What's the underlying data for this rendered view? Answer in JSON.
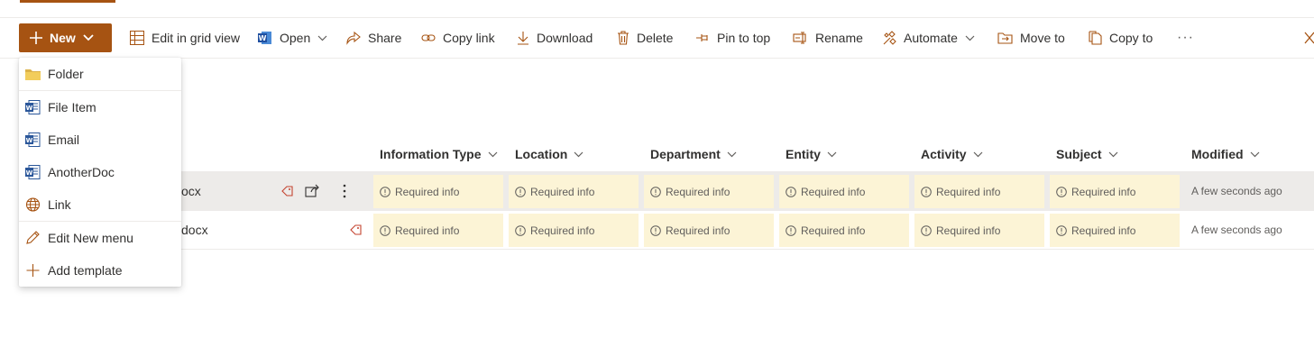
{
  "toolbar": {
    "new_label": "New",
    "commands": [
      {
        "label": "Edit in grid view",
        "icon": "grid-icon"
      },
      {
        "label": "Open",
        "icon": "word-icon"
      },
      {
        "label": "Share",
        "icon": "share-icon"
      },
      {
        "label": "Copy link",
        "icon": "link-icon"
      },
      {
        "label": "Download",
        "icon": "download-icon"
      },
      {
        "label": "Delete",
        "icon": "trash-icon"
      },
      {
        "label": "Pin to top",
        "icon": "pin-icon"
      },
      {
        "label": "Rename",
        "icon": "rename-icon"
      },
      {
        "label": "Automate",
        "icon": "automate-icon"
      },
      {
        "label": "Move to",
        "icon": "move-icon"
      },
      {
        "label": "Copy to",
        "icon": "copy-icon"
      }
    ],
    "more": "···"
  },
  "new_menu": {
    "items": [
      {
        "label": "Folder",
        "icon": "folder-icon"
      },
      {
        "label": "File Item",
        "icon": "word-doc-icon"
      },
      {
        "label": "Email",
        "icon": "word-doc-icon"
      },
      {
        "label": "AnotherDoc",
        "icon": "word-doc-icon"
      },
      {
        "label": "Link",
        "icon": "globe-icon"
      },
      {
        "label": "Edit New menu",
        "icon": "pencil-icon"
      },
      {
        "label": "Add template",
        "icon": "plus-icon"
      }
    ]
  },
  "columns": [
    "Information Type",
    "Location",
    "Department",
    "Entity",
    "Activity",
    "Subject",
    "Modified"
  ],
  "rows": [
    {
      "name": "ocx",
      "cells": [
        "Required info",
        "Required info",
        "Required info",
        "Required info",
        "Required info",
        "Required info"
      ],
      "modified": "A few seconds ago"
    },
    {
      "name": "docx",
      "cells": [
        "Required info",
        "Required info",
        "Required info",
        "Required info",
        "Required info",
        "Required info"
      ],
      "modified": "A few seconds ago"
    }
  ],
  "colors": {
    "accent": "#a65312",
    "required_bg": "#fcf4d6",
    "selected_row": "#edebe9"
  }
}
